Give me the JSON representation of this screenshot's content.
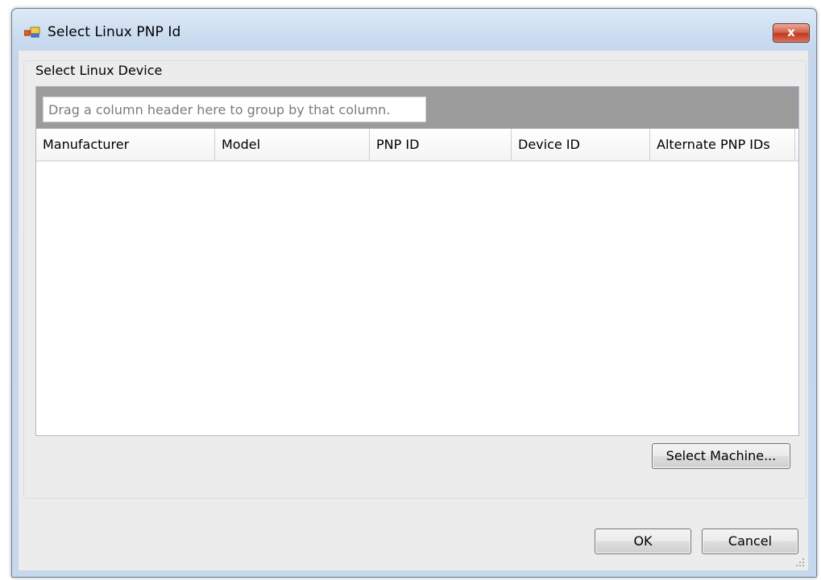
{
  "window": {
    "title": "Select Linux PNP Id",
    "close_label": "x"
  },
  "group": {
    "label": "Select Linux Device",
    "grid": {
      "group_hint": "Drag a column header here to group by that column.",
      "columns": [
        "Manufacturer",
        "Model",
        "PNP ID",
        "Device ID",
        "Alternate PNP IDs"
      ],
      "rows": []
    },
    "select_machine_label": "Select Machine..."
  },
  "buttons": {
    "ok_label": "OK",
    "cancel_label": "Cancel"
  },
  "colors": {
    "group_panel": "#9b9b9b",
    "close_button": "#c9452a",
    "title_bar": "#c8daee"
  }
}
